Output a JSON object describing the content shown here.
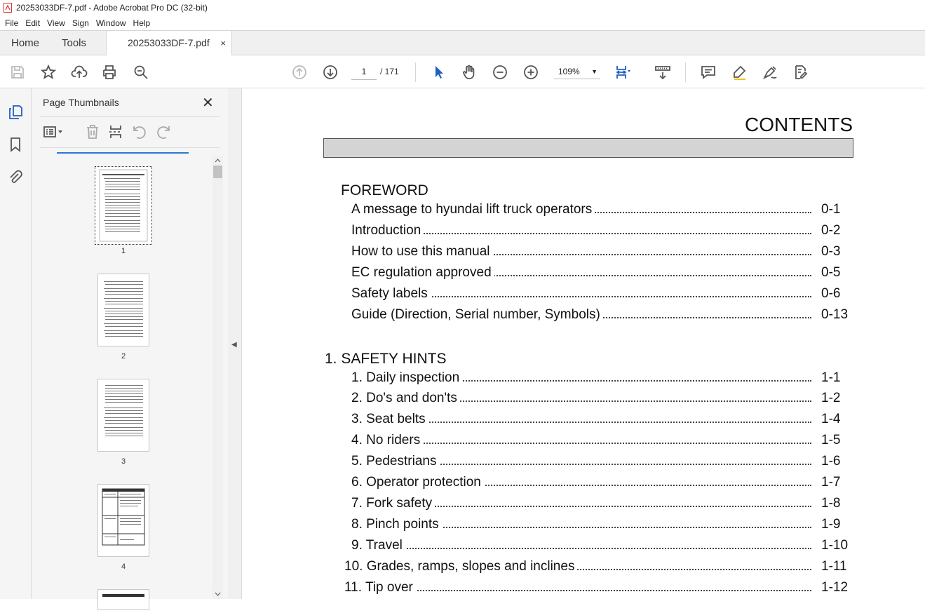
{
  "window": {
    "title": "20253033DF-7.pdf - Adobe Acrobat Pro DC (32-bit)"
  },
  "menu": [
    "File",
    "Edit",
    "View",
    "Sign",
    "Window",
    "Help"
  ],
  "tabs": {
    "home": "Home",
    "tools": "Tools",
    "document": "20253033DF-7.pdf",
    "close": "×"
  },
  "toolbar": {
    "page_current": "1",
    "page_total": "/ 171",
    "zoom": "109%"
  },
  "panel": {
    "title": "Page Thumbnails",
    "close": "✕",
    "thumbnails": [
      "1",
      "2",
      "3",
      "4"
    ]
  },
  "document": {
    "title": "CONTENTS",
    "sections": [
      {
        "heading": "FOREWORD",
        "items": [
          {
            "label": "A message to hyundai lift truck operators",
            "page": "0-1"
          },
          {
            "label": "Introduction",
            "page": "0-2"
          },
          {
            "label": "How to use this manual",
            "page": "0-3"
          },
          {
            "label": "EC regulation approved",
            "page": "0-5"
          },
          {
            "label": "Safety labels",
            "page": "0-6"
          },
          {
            "label": "Guide (Direction, Serial number, Symbols)",
            "page": "0-13"
          }
        ]
      },
      {
        "heading": "1. SAFETY HINTS",
        "items": [
          {
            "label": "1. Daily inspection",
            "page": "1-1"
          },
          {
            "label": "2. Do's and don'ts",
            "page": "1-2"
          },
          {
            "label": "3. Seat belts",
            "page": "1-4"
          },
          {
            "label": "4. No riders",
            "page": "1-5"
          },
          {
            "label": "5. Pedestrians",
            "page": "1-6"
          },
          {
            "label": "6. Operator protection",
            "page": "1-7"
          },
          {
            "label": "7. Fork safety",
            "page": "1-8"
          },
          {
            "label": "8. Pinch points",
            "page": "1-9"
          },
          {
            "label": "9. Travel",
            "page": "1-10"
          },
          {
            "label": "10. Grades, ramps, slopes and inclines",
            "page": "1-11"
          },
          {
            "label": "11. Tip over",
            "page": "1-12"
          }
        ]
      }
    ]
  }
}
